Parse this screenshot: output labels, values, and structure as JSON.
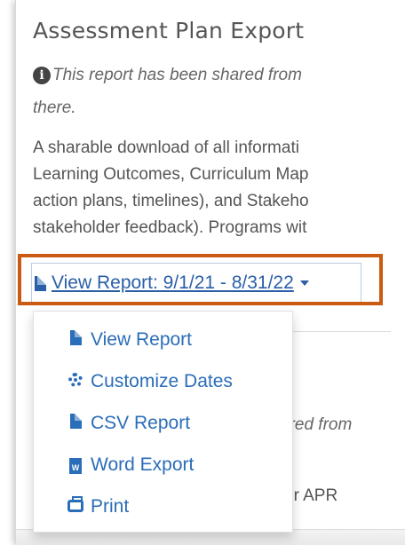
{
  "header": {
    "title": "Assessment Plan Export"
  },
  "info": {
    "icon": "info-circle-icon",
    "line1": "This report has been shared from",
    "line2": "there."
  },
  "description": {
    "lines": [
      "A sharable download of all informati",
      "Learning Outcomes, Curriculum Map",
      "action plans, timelines), and Stakeho",
      "stakeholder feedback). Programs wit"
    ]
  },
  "report_dropdown": {
    "label": "View Report: 9/1/21 - 8/31/22",
    "icon": "file-icon",
    "highlight_color": "#c95b12"
  },
  "menu": {
    "items": [
      {
        "label": "View Report",
        "icon": "file-icon"
      },
      {
        "label": "Customize Dates",
        "icon": "gear-icon"
      },
      {
        "label": "CSV Report",
        "icon": "file-icon"
      },
      {
        "label": "Word Export",
        "icon": "word-file-icon"
      },
      {
        "label": "Print",
        "icon": "print-icon"
      }
    ]
  },
  "background": {
    "shared_fragment": "ared from",
    "apr_fragment": "or APR"
  },
  "colors": {
    "link": "#2a5fa8",
    "menu_link": "#2a6db8",
    "text": "#555555"
  }
}
